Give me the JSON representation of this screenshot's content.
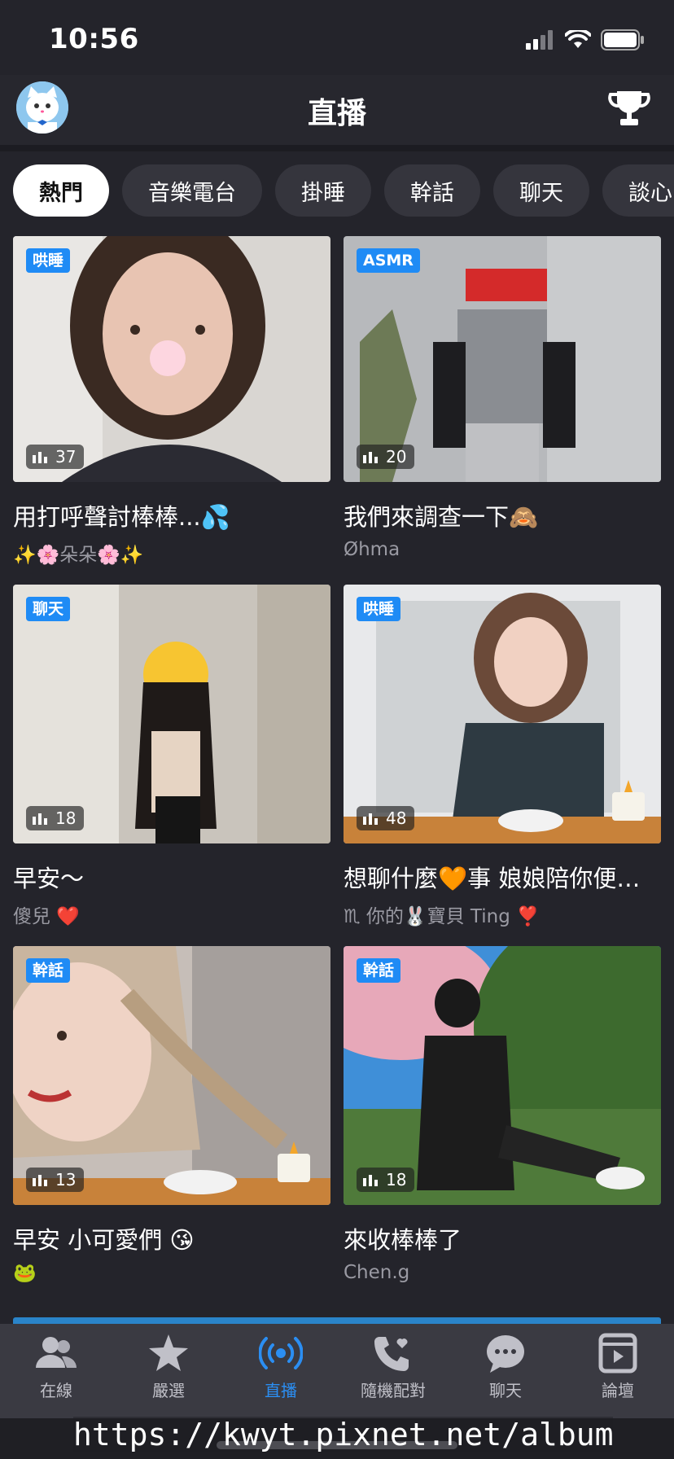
{
  "status_bar": {
    "time": "10:56"
  },
  "header": {
    "title": "直播",
    "avatar_icon": "cat-avatar-icon",
    "trophy_icon": "trophy-icon"
  },
  "tabs": [
    {
      "label": "熱門",
      "active": true
    },
    {
      "label": "音樂電台"
    },
    {
      "label": "掛睡"
    },
    {
      "label": "幹話"
    },
    {
      "label": "聊天"
    },
    {
      "label": "談心"
    }
  ],
  "streams": [
    {
      "tag": "哄睡",
      "viewers": "37",
      "title": "用打呼聲討棒棒...💦",
      "host": "✨🌸朵朵🌸✨"
    },
    {
      "tag": "ASMR",
      "viewers": "20",
      "title": "我們來調查一下🙈",
      "host": "Øhma"
    },
    {
      "tag": "聊天",
      "viewers": "18",
      "title": "早安～",
      "host": "傻兒 ❤️"
    },
    {
      "tag": "哄睡",
      "viewers": "48",
      "title": "想聊什麼🧡事 娘娘陪你便當時間",
      "host": "♏ 你的🐰寶貝 Ting ❣️"
    },
    {
      "tag": "幹話",
      "viewers": "13",
      "title": "早安 小可愛們 😘",
      "host": "🐸"
    },
    {
      "tag": "幹話",
      "viewers": "18",
      "title": "來收棒棒了",
      "host": "Chen.g"
    }
  ],
  "bottom_nav": [
    {
      "label": "在線",
      "icon": "people-icon"
    },
    {
      "label": "嚴選",
      "icon": "star-icon"
    },
    {
      "label": "直播",
      "icon": "broadcast-icon",
      "active": true
    },
    {
      "label": "隨機配對",
      "icon": "phone-heart-icon"
    },
    {
      "label": "聊天",
      "icon": "chat-bubble-icon"
    },
    {
      "label": "論壇",
      "icon": "forum-icon"
    }
  ],
  "watermark": "https://kwyt.pixnet.net/album",
  "colors": {
    "accent": "#2b8ef2",
    "badge": "#1f8bf5",
    "background": "#24242b"
  }
}
